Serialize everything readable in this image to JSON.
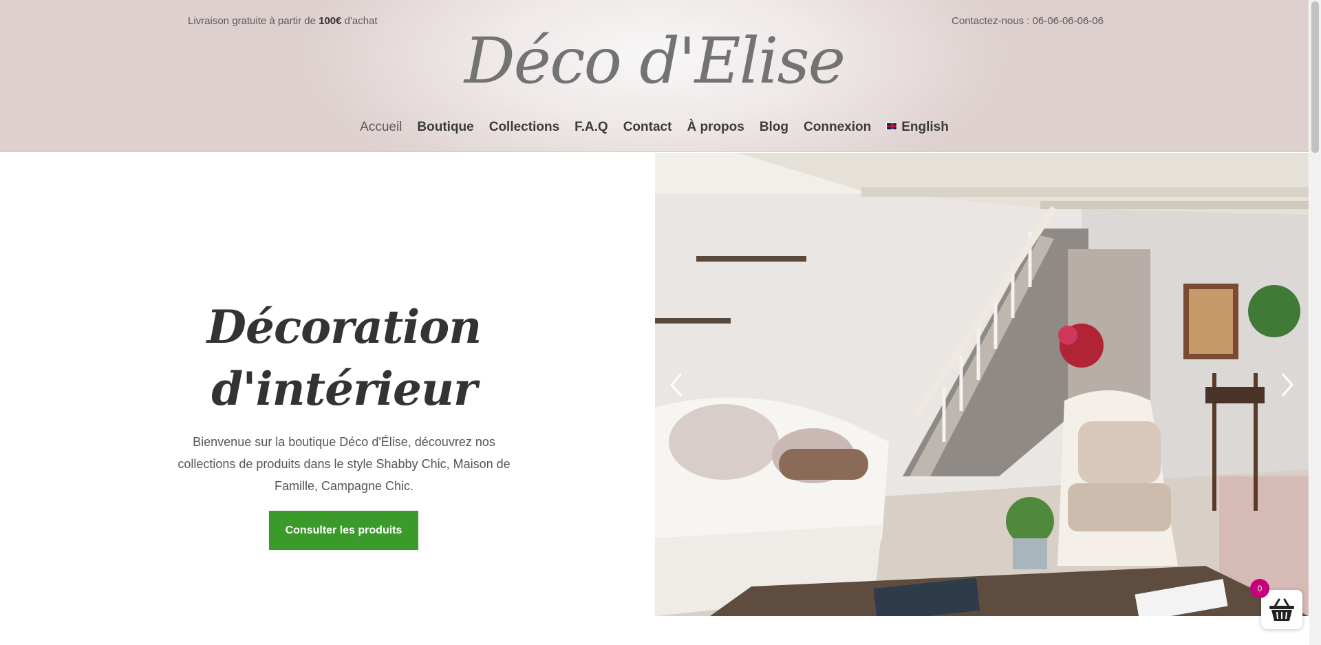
{
  "topbar": {
    "shipping_prefix": "Livraison gratuite à partir de ",
    "shipping_amount": "100€",
    "shipping_suffix": " d'achat",
    "contact": "Contactez-nous : 06-06-06-06-06"
  },
  "logo": {
    "text": "Déco d'Elise"
  },
  "nav": {
    "items": [
      {
        "label": "Accueil",
        "active": true
      },
      {
        "label": "Boutique"
      },
      {
        "label": "Collections"
      },
      {
        "label": "F.A.Q"
      },
      {
        "label": "Contact"
      },
      {
        "label": "À propos"
      },
      {
        "label": "Blog"
      },
      {
        "label": "Connexion"
      },
      {
        "label": "English",
        "icon": "uk-flag-icon"
      }
    ]
  },
  "hero": {
    "title_line1": "Décoration",
    "title_line2": "d'intérieur",
    "text": "Bienvenue sur la boutique Déco d'Élise, découvrez nos collections de produits dans le style Shabby Chic, Maison de Famille, Campagne Chic.",
    "cta_label": "Consulter les produits",
    "prev_icon": "chevron-left-icon",
    "next_icon": "chevron-right-icon"
  },
  "cart": {
    "count": "0",
    "icon": "basket-icon"
  },
  "colors": {
    "cta": "#3a9a2a",
    "badge": "#c4007a",
    "header_bg": "#e6dcda"
  }
}
